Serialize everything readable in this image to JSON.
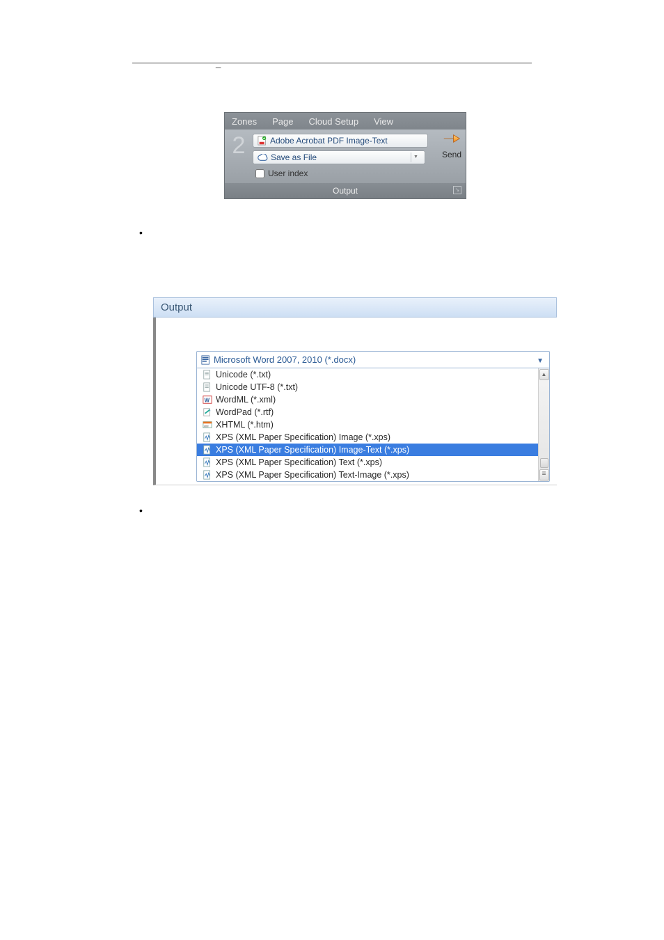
{
  "ribbon": {
    "tabs": [
      "Zones",
      "Page",
      "Cloud Setup",
      "View"
    ],
    "step_number": "2",
    "format_selector": {
      "icon": "pdf-icon",
      "label": "Adobe Acrobat PDF Image-Text"
    },
    "dest_selector": {
      "icon": "cloud-icon",
      "label": "Save as File"
    },
    "user_index": {
      "label": "User index",
      "checked": false
    },
    "send_label": "Send",
    "group_label": "Output"
  },
  "output_panel": {
    "title": "Output",
    "selected": {
      "icon": "docx-icon",
      "label": "Microsoft Word 2007, 2010 (*.docx)"
    },
    "list": [
      {
        "icon": "txt-icon",
        "label": "Unicode (*.txt)"
      },
      {
        "icon": "txt-icon",
        "label": "Unicode UTF-8 (*.txt)"
      },
      {
        "icon": "wordml-icon",
        "label": "WordML (*.xml)"
      },
      {
        "icon": "wordpad-icon",
        "label": "WordPad (*.rtf)"
      },
      {
        "icon": "xhtml-icon",
        "label": "XHTML (*.htm)"
      },
      {
        "icon": "xps-icon",
        "label": "XPS (XML Paper Specification) Image (*.xps)"
      },
      {
        "icon": "xps-icon",
        "label": "XPS (XML Paper Specification) Image-Text (*.xps)",
        "selected": true
      },
      {
        "icon": "xps-icon",
        "label": "XPS (XML Paper Specification) Text (*.xps)"
      },
      {
        "icon": "xps-icon",
        "label": "XPS (XML Paper Specification) Text-Image (*.xps)"
      }
    ]
  }
}
